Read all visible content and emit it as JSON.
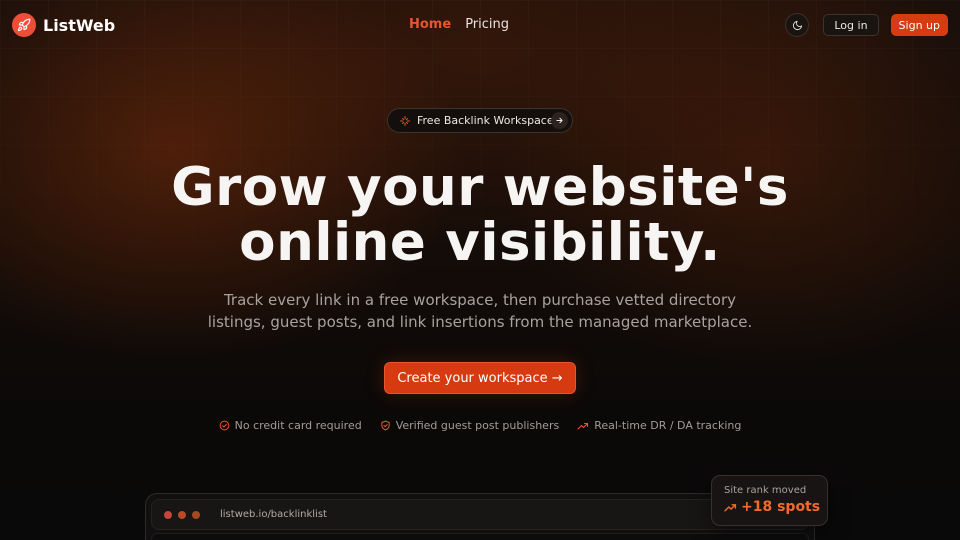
{
  "header": {
    "brand": "ListWeb",
    "nav": [
      {
        "label": "Home",
        "active": true
      },
      {
        "label": "Pricing",
        "active": false
      }
    ],
    "login_label": "Log in",
    "signup_label": "Sign up"
  },
  "hero": {
    "badge_label": "Free Backlink Workspace",
    "title_line1": "Grow your website's",
    "title_line2": "online visibility.",
    "subtitle_line1": "Track every link in a free workspace, then purchase vetted directory",
    "subtitle_line2": "listings, guest posts, and link insertions from the managed marketplace.",
    "cta_label": "Create your workspace →"
  },
  "features": [
    {
      "icon": "check-circle-icon",
      "label": "No credit card required"
    },
    {
      "icon": "shield-check-icon",
      "label": "Verified guest post publishers"
    },
    {
      "icon": "trending-up-icon",
      "label": "Real-time DR / DA tracking"
    }
  ],
  "browser": {
    "url": "listweb.io/backlinklist"
  },
  "rank_card": {
    "label": "Site rank moved",
    "value": "+18 spots"
  },
  "colors": {
    "accent": "#d63b12",
    "accent_text": "#e4572e",
    "logo": "#ee4e37",
    "background": "#0b0908"
  }
}
